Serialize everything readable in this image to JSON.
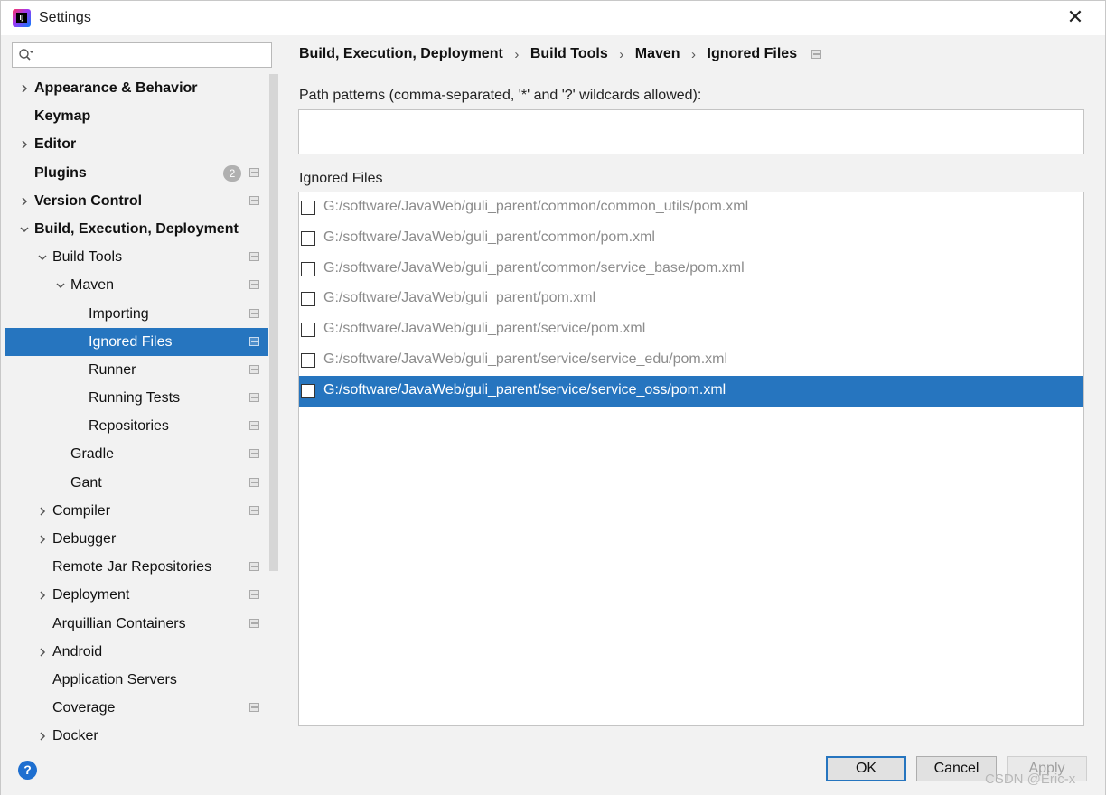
{
  "window": {
    "title": "Settings",
    "app_icon_text": "IJ",
    "close_glyph": "✕"
  },
  "sidebar": {
    "search_placeholder": "",
    "items": [
      {
        "label": "Appearance & Behavior",
        "bold": true,
        "level": 0,
        "expandable": true,
        "expanded": false,
        "project": false
      },
      {
        "label": "Keymap",
        "bold": true,
        "level": 0,
        "expandable": false,
        "project": false
      },
      {
        "label": "Editor",
        "bold": true,
        "level": 0,
        "expandable": true,
        "expanded": false,
        "project": false
      },
      {
        "label": "Plugins",
        "bold": true,
        "level": 0,
        "expandable": false,
        "badge": "2",
        "project": true
      },
      {
        "label": "Version Control",
        "bold": true,
        "level": 0,
        "expandable": true,
        "expanded": false,
        "project": true
      },
      {
        "label": "Build, Execution, Deployment",
        "bold": true,
        "level": 0,
        "expandable": true,
        "expanded": true,
        "project": false
      },
      {
        "label": "Build Tools",
        "bold": false,
        "level": 1,
        "expandable": true,
        "expanded": true,
        "project": true
      },
      {
        "label": "Maven",
        "bold": false,
        "level": 2,
        "expandable": true,
        "expanded": true,
        "project": true
      },
      {
        "label": "Importing",
        "bold": false,
        "level": 3,
        "expandable": false,
        "project": true
      },
      {
        "label": "Ignored Files",
        "bold": false,
        "level": 3,
        "expandable": false,
        "project": true,
        "selected": true
      },
      {
        "label": "Runner",
        "bold": false,
        "level": 3,
        "expandable": false,
        "project": true
      },
      {
        "label": "Running Tests",
        "bold": false,
        "level": 3,
        "expandable": false,
        "project": true
      },
      {
        "label": "Repositories",
        "bold": false,
        "level": 3,
        "expandable": false,
        "project": true
      },
      {
        "label": "Gradle",
        "bold": false,
        "level": 2,
        "expandable": false,
        "project": true
      },
      {
        "label": "Gant",
        "bold": false,
        "level": 2,
        "expandable": false,
        "project": true
      },
      {
        "label": "Compiler",
        "bold": false,
        "level": 1,
        "expandable": true,
        "expanded": false,
        "project": true
      },
      {
        "label": "Debugger",
        "bold": false,
        "level": 1,
        "expandable": true,
        "expanded": false,
        "project": false
      },
      {
        "label": "Remote Jar Repositories",
        "bold": false,
        "level": 1,
        "expandable": false,
        "project": true
      },
      {
        "label": "Deployment",
        "bold": false,
        "level": 1,
        "expandable": true,
        "expanded": false,
        "project": true
      },
      {
        "label": "Arquillian Containers",
        "bold": false,
        "level": 1,
        "expandable": false,
        "project": true
      },
      {
        "label": "Android",
        "bold": false,
        "level": 1,
        "expandable": true,
        "expanded": false,
        "project": false
      },
      {
        "label": "Application Servers",
        "bold": false,
        "level": 1,
        "expandable": false,
        "project": false
      },
      {
        "label": "Coverage",
        "bold": false,
        "level": 1,
        "expandable": false,
        "project": true
      },
      {
        "label": "Docker",
        "bold": false,
        "level": 1,
        "expandable": true,
        "expanded": false,
        "project": false
      }
    ]
  },
  "content": {
    "breadcrumb": [
      "Build, Execution, Deployment",
      "Build Tools",
      "Maven",
      "Ignored Files"
    ],
    "breadcrumb_separator": "›",
    "path_patterns_label": "Path patterns (comma-separated, '*' and '?' wildcards allowed):",
    "path_patterns_value": "",
    "ignored_files_label": "Ignored Files",
    "ignored_files": [
      {
        "path": "G:/software/JavaWeb/guli_parent/common/common_utils/pom.xml",
        "checked": false,
        "selected": false
      },
      {
        "path": "G:/software/JavaWeb/guli_parent/common/pom.xml",
        "checked": false,
        "selected": false
      },
      {
        "path": "G:/software/JavaWeb/guli_parent/common/service_base/pom.xml",
        "checked": false,
        "selected": false
      },
      {
        "path": "G:/software/JavaWeb/guli_parent/pom.xml",
        "checked": false,
        "selected": false
      },
      {
        "path": "G:/software/JavaWeb/guli_parent/service/pom.xml",
        "checked": false,
        "selected": false
      },
      {
        "path": "G:/software/JavaWeb/guli_parent/service/service_edu/pom.xml",
        "checked": false,
        "selected": false
      },
      {
        "path": "G:/software/JavaWeb/guli_parent/service/service_oss/pom.xml",
        "checked": false,
        "selected": true
      }
    ]
  },
  "footer": {
    "help_glyph": "?",
    "ok_label": "OK",
    "cancel_label": "Cancel",
    "apply_label": "Apply",
    "watermark": "CSDN @Eric-x"
  },
  "colors": {
    "selection": "#2675bf",
    "window_bg": "#f2f2f2",
    "muted_path": "#8c8c8c"
  }
}
